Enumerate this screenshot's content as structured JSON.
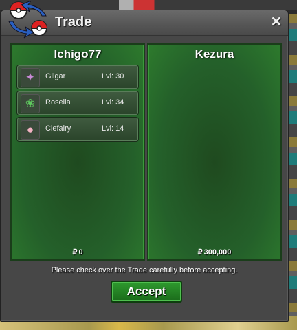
{
  "window": {
    "title": "Trade",
    "close_icon": "close-icon"
  },
  "left_panel": {
    "player_name": "Ichigo77",
    "currency_symbol": "₽",
    "money": "0",
    "pokemon": [
      {
        "name": "Gligar",
        "level": "Lvl: 30",
        "icon": "gligar-sprite-icon"
      },
      {
        "name": "Roselia",
        "level": "Lvl: 34",
        "icon": "roselia-sprite-icon"
      },
      {
        "name": "Clefairy",
        "level": "Lvl: 14",
        "icon": "clefairy-sprite-icon"
      }
    ]
  },
  "right_panel": {
    "player_name": "Kezura",
    "currency_symbol": "₽",
    "money": "300,000",
    "pokemon": []
  },
  "notice": "Please check over the Trade carefully before accepting.",
  "accept_label": "Accept",
  "colors": {
    "panel_green": "#24602a",
    "accept_green": "#2e9a2e",
    "window_gray": "#474747"
  }
}
